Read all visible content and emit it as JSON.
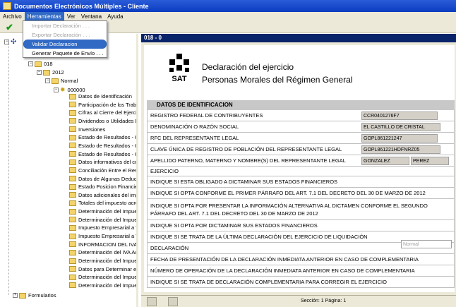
{
  "app": {
    "title": "Documentos Electrónicos Múltiples - Cliente"
  },
  "menubar": [
    "Archivo",
    "Herramientas",
    "Ver",
    "Ventana",
    "Ayuda"
  ],
  "tools_menu": [
    {
      "label": "Importar Declaración . . .",
      "state": "disabled"
    },
    {
      "label": "Exportar Declaración . . .",
      "state": "disabled"
    },
    {
      "label": "Validar Declaracion",
      "state": "selected"
    },
    {
      "label": "Generar Paquete de Envío . . .",
      "state": "normal"
    }
  ],
  "tree": {
    "year_folder": "018",
    "year": "2012",
    "type": "Normal",
    "declaration": "000000",
    "items": [
      "Datos de Identificación",
      "Participación de los Trabaj",
      "Cifras al Cierre del Ejercic",
      "Dividendos o Utilidades D",
      "Inversiones",
      "Estado de Resultados - G",
      "Estado de Resultados - G",
      "Estado de Resultados - G",
      "Datos informativos del co",
      "Conciliación Entre el Res",
      "Datos de Algunas Deduc",
      "Estado Posicion Financie",
      "Datos adicionales del imp",
      "Totales del impuesto acre",
      "Determinación del Impue",
      "Determinación del Impue",
      "Impuesto Empresarial a T",
      "Impuesto Empresarial a T",
      "INFORMACION DEL IVA",
      "Determinación del IVA Acr",
      "Determinación del Impue",
      "Datos para Determinar el I",
      "Determinación del Impue",
      "Determinación del Impue"
    ],
    "formularios": "Formularios"
  },
  "doc": {
    "tab": "018 - 0",
    "sat_logo": "SAT",
    "sat_sub": "Servicio de Administración Tributaria",
    "title1": "Declaración del ejercicio",
    "title2": "Personas Morales del Régimen General",
    "section": "DATOS DE IDENTIFICACION",
    "rows": [
      "REGISTRO FEDERAL DE CONTRIBUYENTES",
      "DENOMINACIÓN O RAZÓN SOCIAL",
      "RFC DEL REPRESENTANTE LEGAL",
      "CLAVE ÚNICA DE REGISTRO DE POBLACIÓN DEL REPRESENTANTE LEGAL",
      "APELLIDO PATERNO, MATERNO Y NOMBRE(S) DEL REPRESENTANTE LEGAL",
      "EJERCICIO",
      "INDIQUE SI ESTA OBLIGADO A DICTAMINAR SUS ESTADOS FINANCIEROS",
      "INDIQUE SI OPTA CONFORME EL PRIMER PÁRRAFO DEL ART. 7.1 DEL DECRETO DEL 30 DE MARZO DE 2012",
      "INDIQUE SI OPTA POR PRESENTAR LA INFORMACIÓN ALTERNATIVA AL DICTAMEN CONFORME EL SEGUNDO PÁRRAFO DEL ART. 7.1 DEL DECRETO DEL 30 DE MARZO DE 2012",
      "INDIQUE SI OPTA POR DICTAMINAR SUS ESTADOS FINANCIEROS",
      "INDIQUE SI SE TRATA DE LA ÚLTIMA DECLARACIÓN DEL EJERCICIO DE LIQUIDACIÓN",
      "DECLARACIÓN",
      "FECHA DE PRESENTACIÓN DE LA DECLARACIÓN INMEDIATA ANTERIOR EN CASO DE COMPLEMENTARIA",
      "NÚMERO DE OPERACIÓN DE LA DECLARACIÓN INMEDIATA ANTERIOR EN CASO DE COMPLEMENTARIA",
      "INDIQUE SI SE TRATA DE DECLARACIÓN COMPLEMENTARIA PARA CORREGIR EL EJERCICIO"
    ],
    "values": {
      "rfc": "CCR0401276F7",
      "razon": "EL CASTILLO DE CRISTAL",
      "rfc_rep": "GOPL861221247",
      "curp": "GOPL861221HDFNRZ05",
      "apellido1": "GONZALEZ",
      "apellido2": "PEREZ",
      "declaracion": "Normal"
    }
  },
  "status": "Sección: 1  Página: 1"
}
